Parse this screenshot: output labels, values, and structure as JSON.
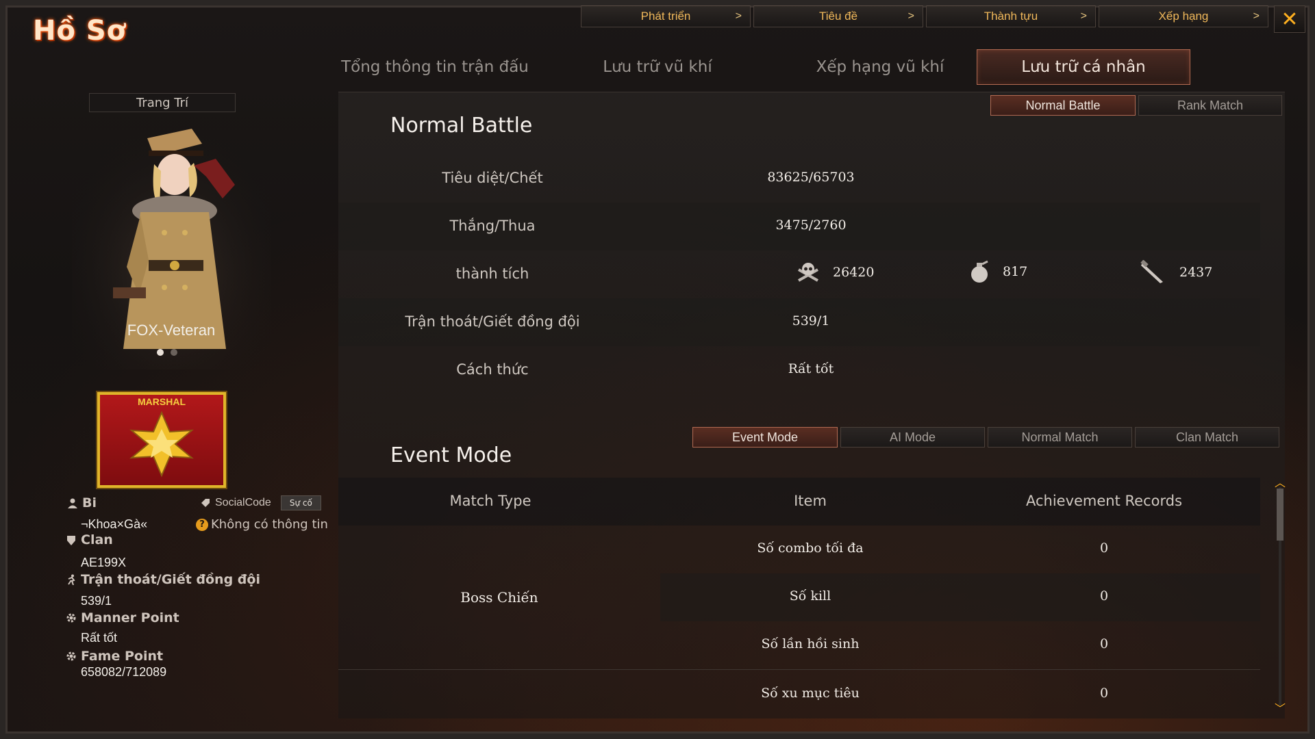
{
  "header": {
    "title": "Hồ Sơ"
  },
  "topnav": [
    {
      "label": "Phát triển"
    },
    {
      "label": "Tiêu đề"
    },
    {
      "label": "Thành tựu"
    },
    {
      "label": "Xếp hạng"
    }
  ],
  "tabs": [
    {
      "label": "Tổng thông tin trận đấu"
    },
    {
      "label": "Lưu trữ vũ khí"
    },
    {
      "label": "Xếp hạng vũ khí"
    },
    {
      "label": "Lưu trữ cá nhân",
      "active": true
    }
  ],
  "profile": {
    "decor_label": "Trang Trí",
    "character_name": "FOX-Veteran",
    "rank_name": "MARSHAL",
    "nickname_label": "Bi",
    "nickname_value": "¬Khoa×Gà«",
    "social_label": "SocialCode",
    "report_button": "Sự cố",
    "social_value": "Không có thông tin",
    "clan_label": "Clan",
    "clan_value": "AE199X",
    "escape_label": "Trận thoát/Giết đồng đội",
    "escape_value": "539/1",
    "manner_label": "Manner Point",
    "manner_value": "Rất tốt",
    "fame_label": "Fame Point",
    "fame_value": "658082/712089"
  },
  "normal": {
    "title": "Normal Battle",
    "toggle": [
      {
        "label": "Normal Battle",
        "active": true
      },
      {
        "label": "Rank Match"
      }
    ],
    "rows": {
      "kd_label": "Tiêu diệt/Chết",
      "kd_value": "83625/65703",
      "wl_label": "Thắng/Thua",
      "wl_value": "3475/2760",
      "ach_label": "thành tích",
      "ach_headshot": "26420",
      "ach_grenade": "817",
      "ach_knife": "2437",
      "escape_label": "Trận thoát/Giết đồng đội",
      "escape_value": "539/1",
      "manner_label": "Cách thức",
      "manner_value": "Rất tốt"
    }
  },
  "event": {
    "title": "Event Mode",
    "toggle": [
      {
        "label": "Event Mode",
        "active": true
      },
      {
        "label": "AI Mode"
      },
      {
        "label": "Normal Match"
      },
      {
        "label": "Clan Match"
      }
    ],
    "headers": {
      "match_type": "Match Type",
      "item": "Item",
      "records": "Achievement Records"
    },
    "group": "Boss Chiến",
    "rows": [
      {
        "item": "Số combo tối đa",
        "value": "0"
      },
      {
        "item": "Số kill",
        "value": "0"
      },
      {
        "item": "Số lần hồi sinh",
        "value": "0"
      },
      {
        "item": "Số xu mục tiêu",
        "value": "0"
      }
    ]
  },
  "icons": {
    "close": "close-icon",
    "user": "user-icon",
    "clan": "clan-icon",
    "escape": "run-icon",
    "manner": "gear-icon",
    "fame": "gear-icon",
    "headshot": "skull-icon",
    "grenade": "grenade-icon",
    "knife": "knife-icon"
  },
  "colors": {
    "accent": "#f0b85a",
    "tab_active_border": "#b26a52",
    "rank_red": "#b2181a",
    "rank_gold": "#e0b52a"
  }
}
